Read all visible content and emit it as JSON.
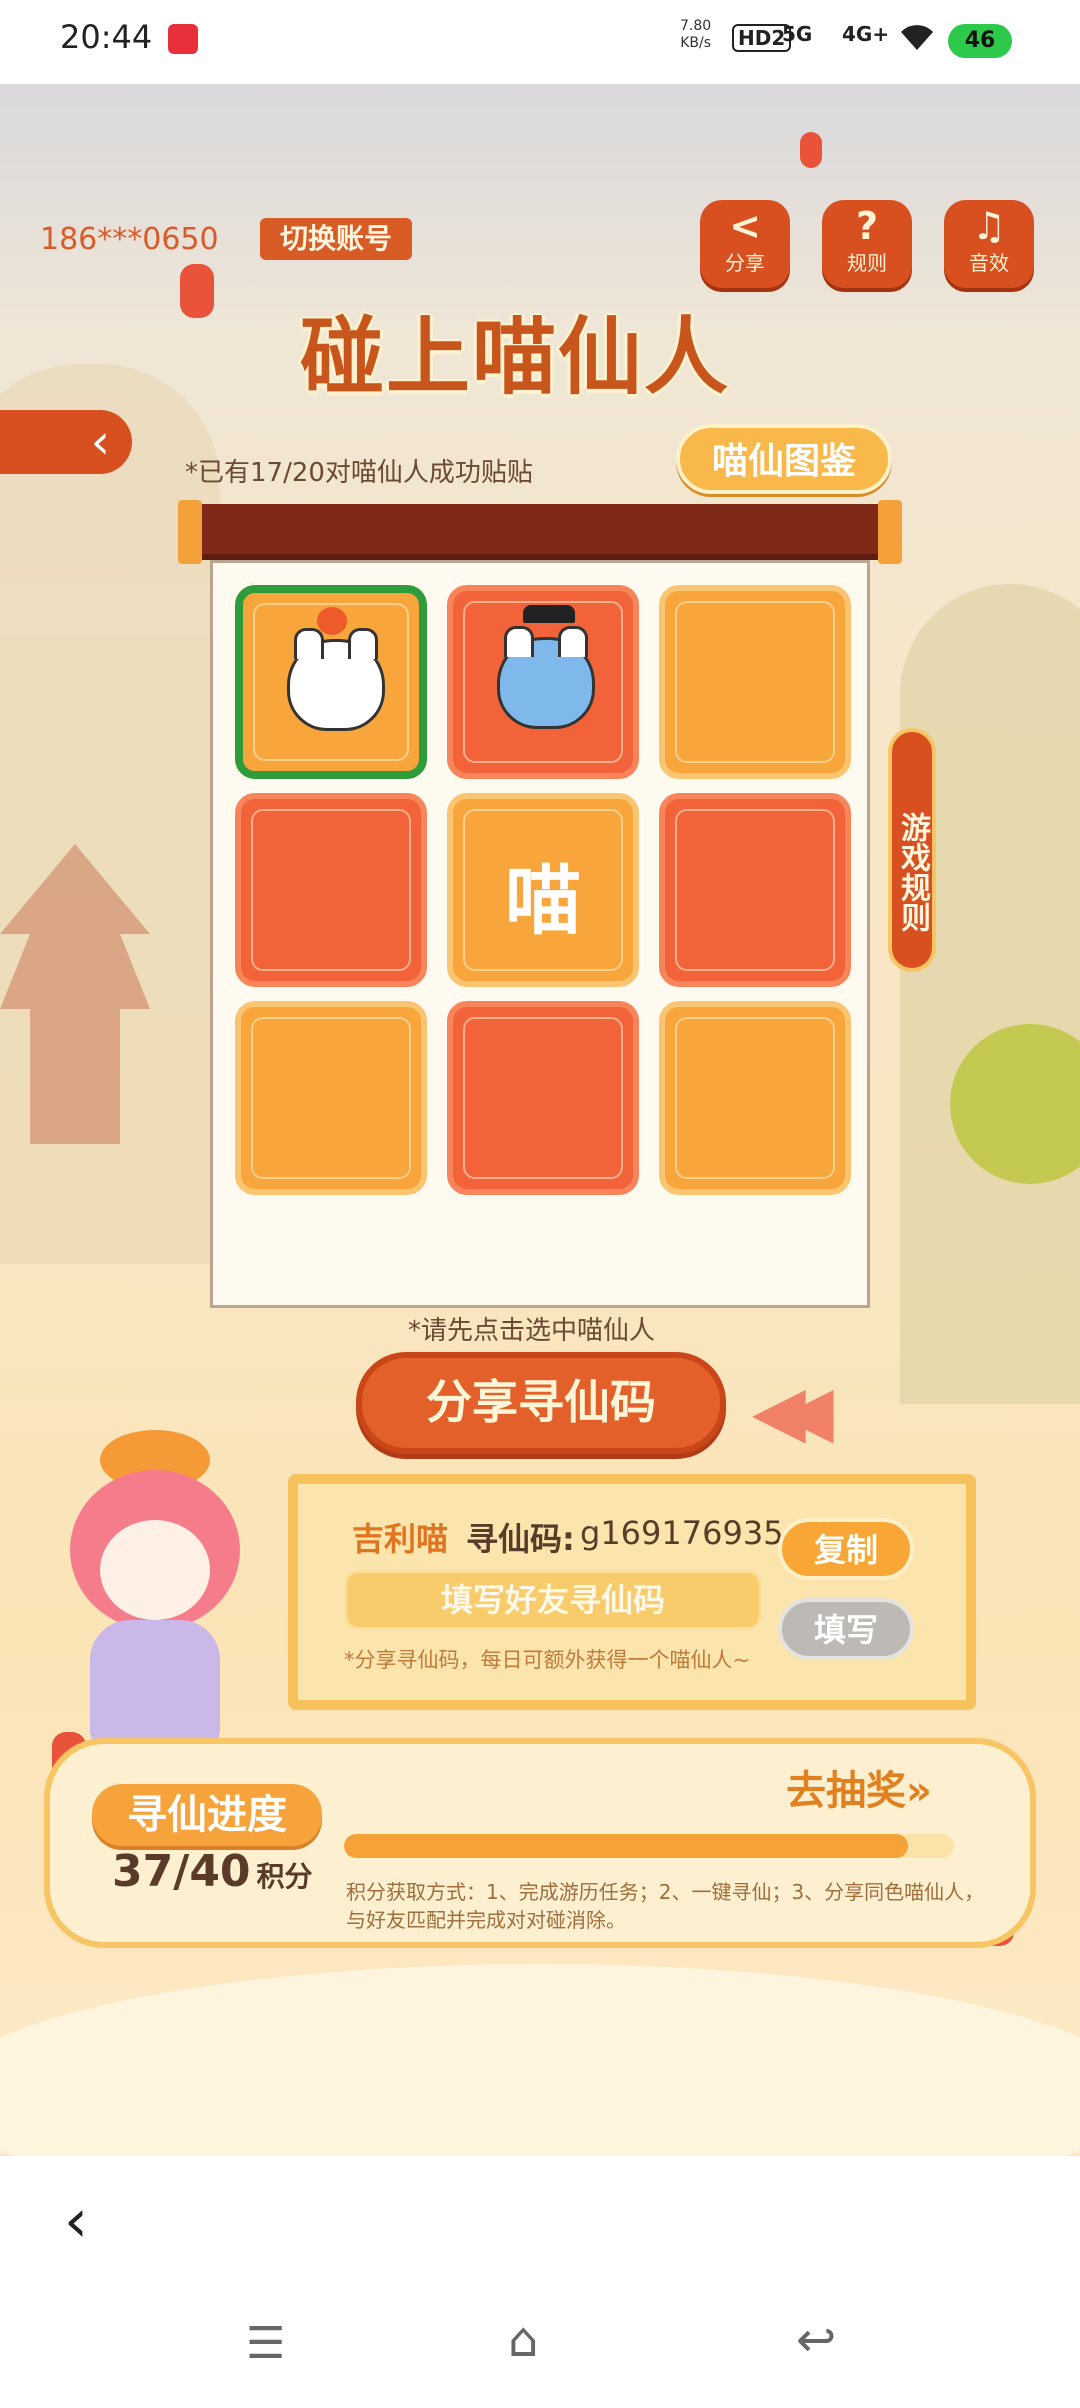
{
  "status_bar": {
    "time": "20:44",
    "net_speed": "7.80",
    "net_unit": "KB/s",
    "hd": "HD2",
    "signal1": "5G",
    "signal2": "4G+",
    "battery": "46",
    "wifi_icon": "wifi-icon"
  },
  "header": {
    "phone": "186***0650",
    "switch_account": "切换账号",
    "share_label": "分享",
    "rules_label": "规则",
    "sound_label": "音效"
  },
  "game": {
    "title": "碰上喵仙人",
    "progress_note": "*已有17/20对喵仙人成功贴贴",
    "atlas_button": "喵仙图鉴",
    "side_rules": "游戏规则",
    "meow_char": "喵",
    "hint": "*请先点击选中喵仙人",
    "share_code_button": "分享寻仙码"
  },
  "code_panel": {
    "name": "吉利喵",
    "code_label": "寻仙码:",
    "code_value": "g169176935",
    "copy_button": "复制",
    "fill_placeholder": "填写好友寻仙码",
    "fill_button": "填写",
    "note": "*分享寻仙码，每日可额外获得一个喵仙人~"
  },
  "progress_panel": {
    "title": "寻仙进度",
    "current": "37",
    "total": "40",
    "unit": "积分",
    "progress_fraction": 0.925,
    "lottery_link": "去抽奖",
    "points_note": "积分获取方式：1、完成游历任务；2、一键寻仙；3、分享同色喵仙人，与好友匹配并完成对对碰消除。"
  },
  "colors": {
    "accent": "#d8501f",
    "selected_border": "#2e9c3a",
    "tile_orange": "#f8a63b",
    "tile_red": "#f2633a"
  }
}
